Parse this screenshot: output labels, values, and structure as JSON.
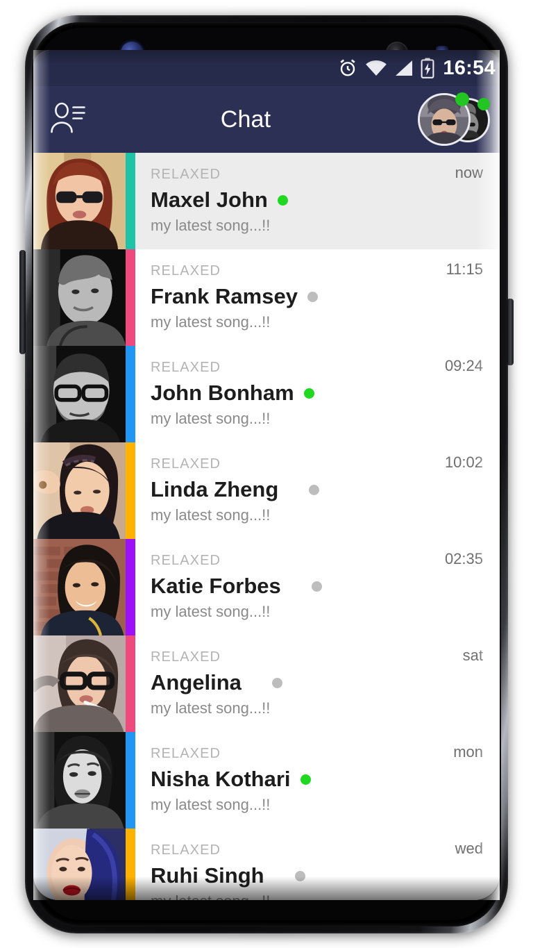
{
  "device": {
    "hardware": {
      "iris_scanner": "iris-scanner",
      "earpiece": "earpiece-speaker",
      "front_camera": "front-camera",
      "proximity_sensor": "proximity-sensor",
      "power_button": "power-button",
      "volume_button": "volume-button"
    }
  },
  "status_bar": {
    "time": "16:54",
    "icons": [
      "alarm-icon",
      "wifi-icon",
      "cellular-signal-icon",
      "battery-charging-icon"
    ],
    "background": "#272b4b"
  },
  "app_bar": {
    "title": "Chat",
    "left_icon": "contacts-list-icon",
    "background": "#2c3055",
    "avatar_stack": {
      "count": 2,
      "presence": [
        "online",
        "online"
      ],
      "presence_color": "#22c522"
    }
  },
  "theme": {
    "online_color": "#1fd81f",
    "offline_color": "#bdbdbd",
    "selected_row_background": "#ececec",
    "row_background": "#ffffff",
    "name_color": "#1d1d1d",
    "mood_color": "#b3b3b3",
    "preview_color": "#8a8a8a",
    "time_color": "#6e6e6e"
  },
  "chat_list": {
    "rows": [
      {
        "mood": "RELAXED",
        "name": "Maxel John",
        "preview": "my latest song...!!",
        "time": "now",
        "presence": "online",
        "accent": "#1fc4a8",
        "selected": true,
        "avatar": "woman-red-hair-glasses"
      },
      {
        "mood": "RELAXED",
        "name": "Frank Ramsey",
        "preview": "my latest song...!!",
        "time": "11:15",
        "presence": "offline",
        "accent": "#ee4a7d",
        "selected": false,
        "avatar": "man-bw-portrait"
      },
      {
        "mood": "RELAXED",
        "name": "John Bonham",
        "preview": "my latest song...!!",
        "time": "09:24",
        "presence": "online",
        "accent": "#2196f3",
        "selected": false,
        "avatar": "man-bw-glasses-beard"
      },
      {
        "mood": "RELAXED",
        "name": "Linda Zheng",
        "preview": "my latest song...!!",
        "time": "10:02",
        "presence": "offline",
        "accent": "#ffb300",
        "selected": false,
        "avatar": "woman-braid-hand"
      },
      {
        "mood": "RELAXED",
        "name": "Katie Forbes",
        "preview": "my latest song...!!",
        "time": "02:35",
        "presence": "offline",
        "accent": "#9c11f5",
        "selected": false,
        "avatar": "woman-smiling-brick-wall"
      },
      {
        "mood": "RELAXED",
        "name": "Angelina",
        "preview": "my latest song...!!",
        "time": "sat",
        "presence": "offline",
        "accent": "#ee4a7d",
        "selected": false,
        "avatar": "woman-glasses-cigarette"
      },
      {
        "mood": "RELAXED",
        "name": "Nisha Kothari",
        "preview": "my latest song...!!",
        "time": "mon",
        "presence": "online",
        "accent": "#2196f3",
        "selected": false,
        "avatar": "woman-bw-portrait"
      },
      {
        "mood": "RELAXED",
        "name": "Ruhi Singh",
        "preview": "my latest song...!!",
        "time": "wed",
        "presence": "offline",
        "accent": "#ffb300",
        "selected": false,
        "avatar": "woman-blue-hair-red-lips"
      }
    ]
  }
}
